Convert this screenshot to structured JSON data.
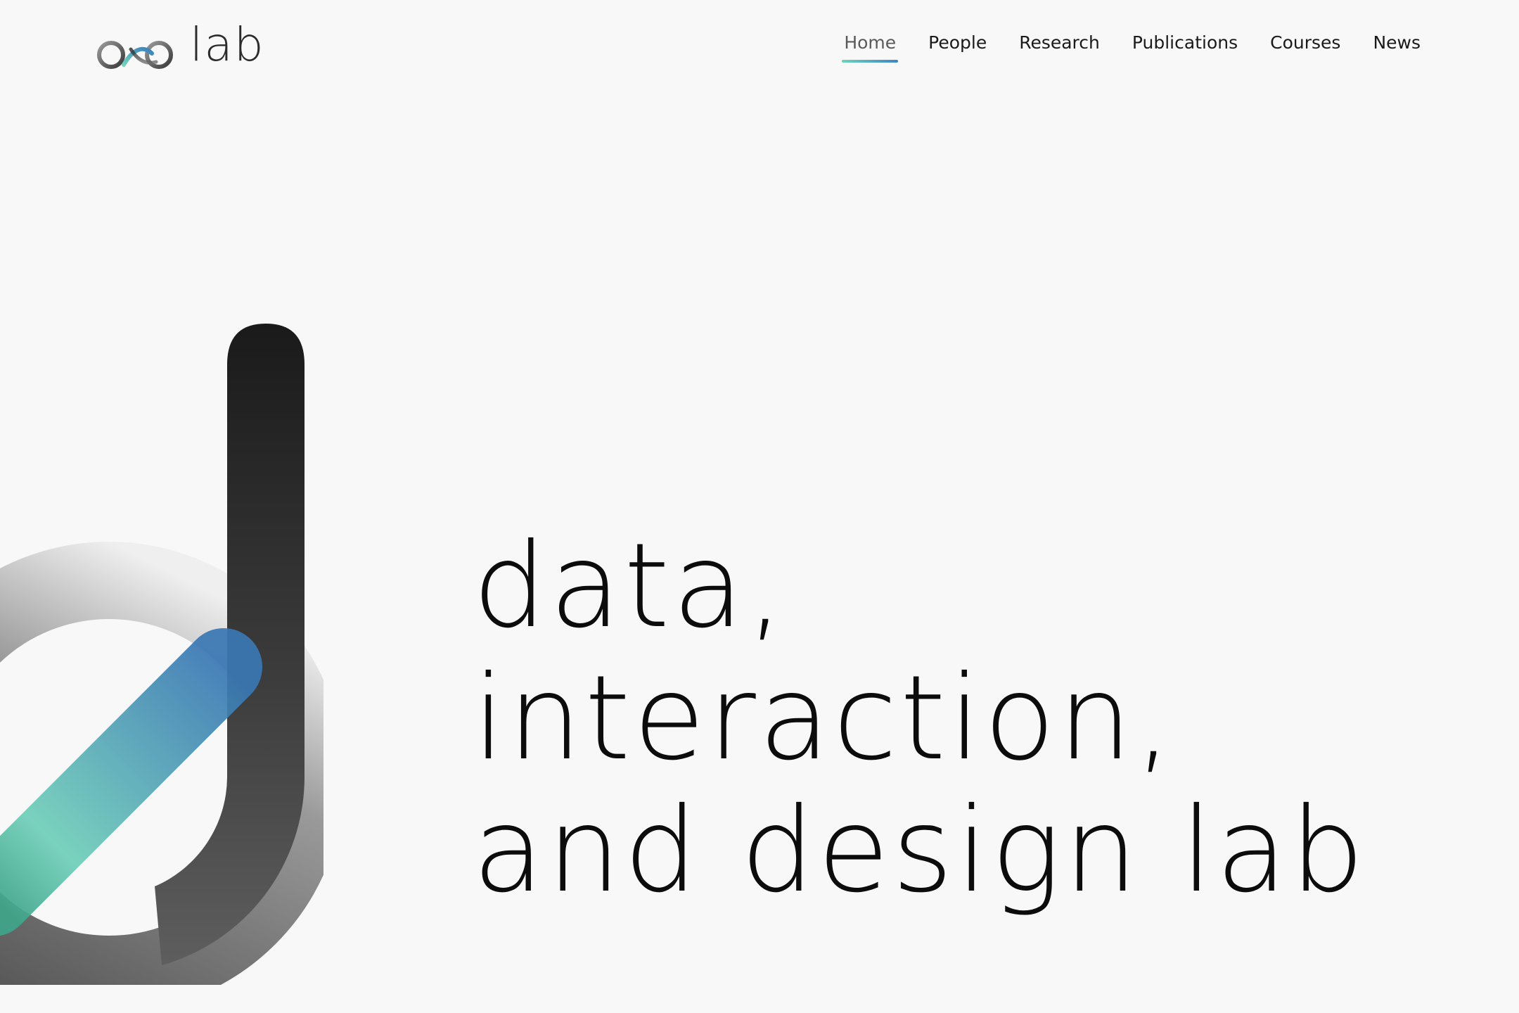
{
  "brand": {
    "logo_text": "lab",
    "logo_mark_letters": "dxd"
  },
  "nav": {
    "items": [
      {
        "label": "Home",
        "active": true
      },
      {
        "label": "People",
        "active": false
      },
      {
        "label": "Research",
        "active": false
      },
      {
        "label": "Publications",
        "active": false
      },
      {
        "label": "Courses",
        "active": false
      },
      {
        "label": "News",
        "active": false
      }
    ]
  },
  "hero": {
    "lines": [
      "data,",
      "interaction,",
      "and design lab"
    ]
  },
  "colors": {
    "background": "#f8f8f8",
    "text": "#0c0c0c",
    "accent_teal": "#6dd3bb",
    "accent_blue": "#3d85c8",
    "mark_dark": "#1c1c1c",
    "mark_gray": "#666666"
  },
  "icons": {
    "logo_mark": "dxd-logo-icon",
    "hero_mark": "large-d-mark-icon"
  }
}
